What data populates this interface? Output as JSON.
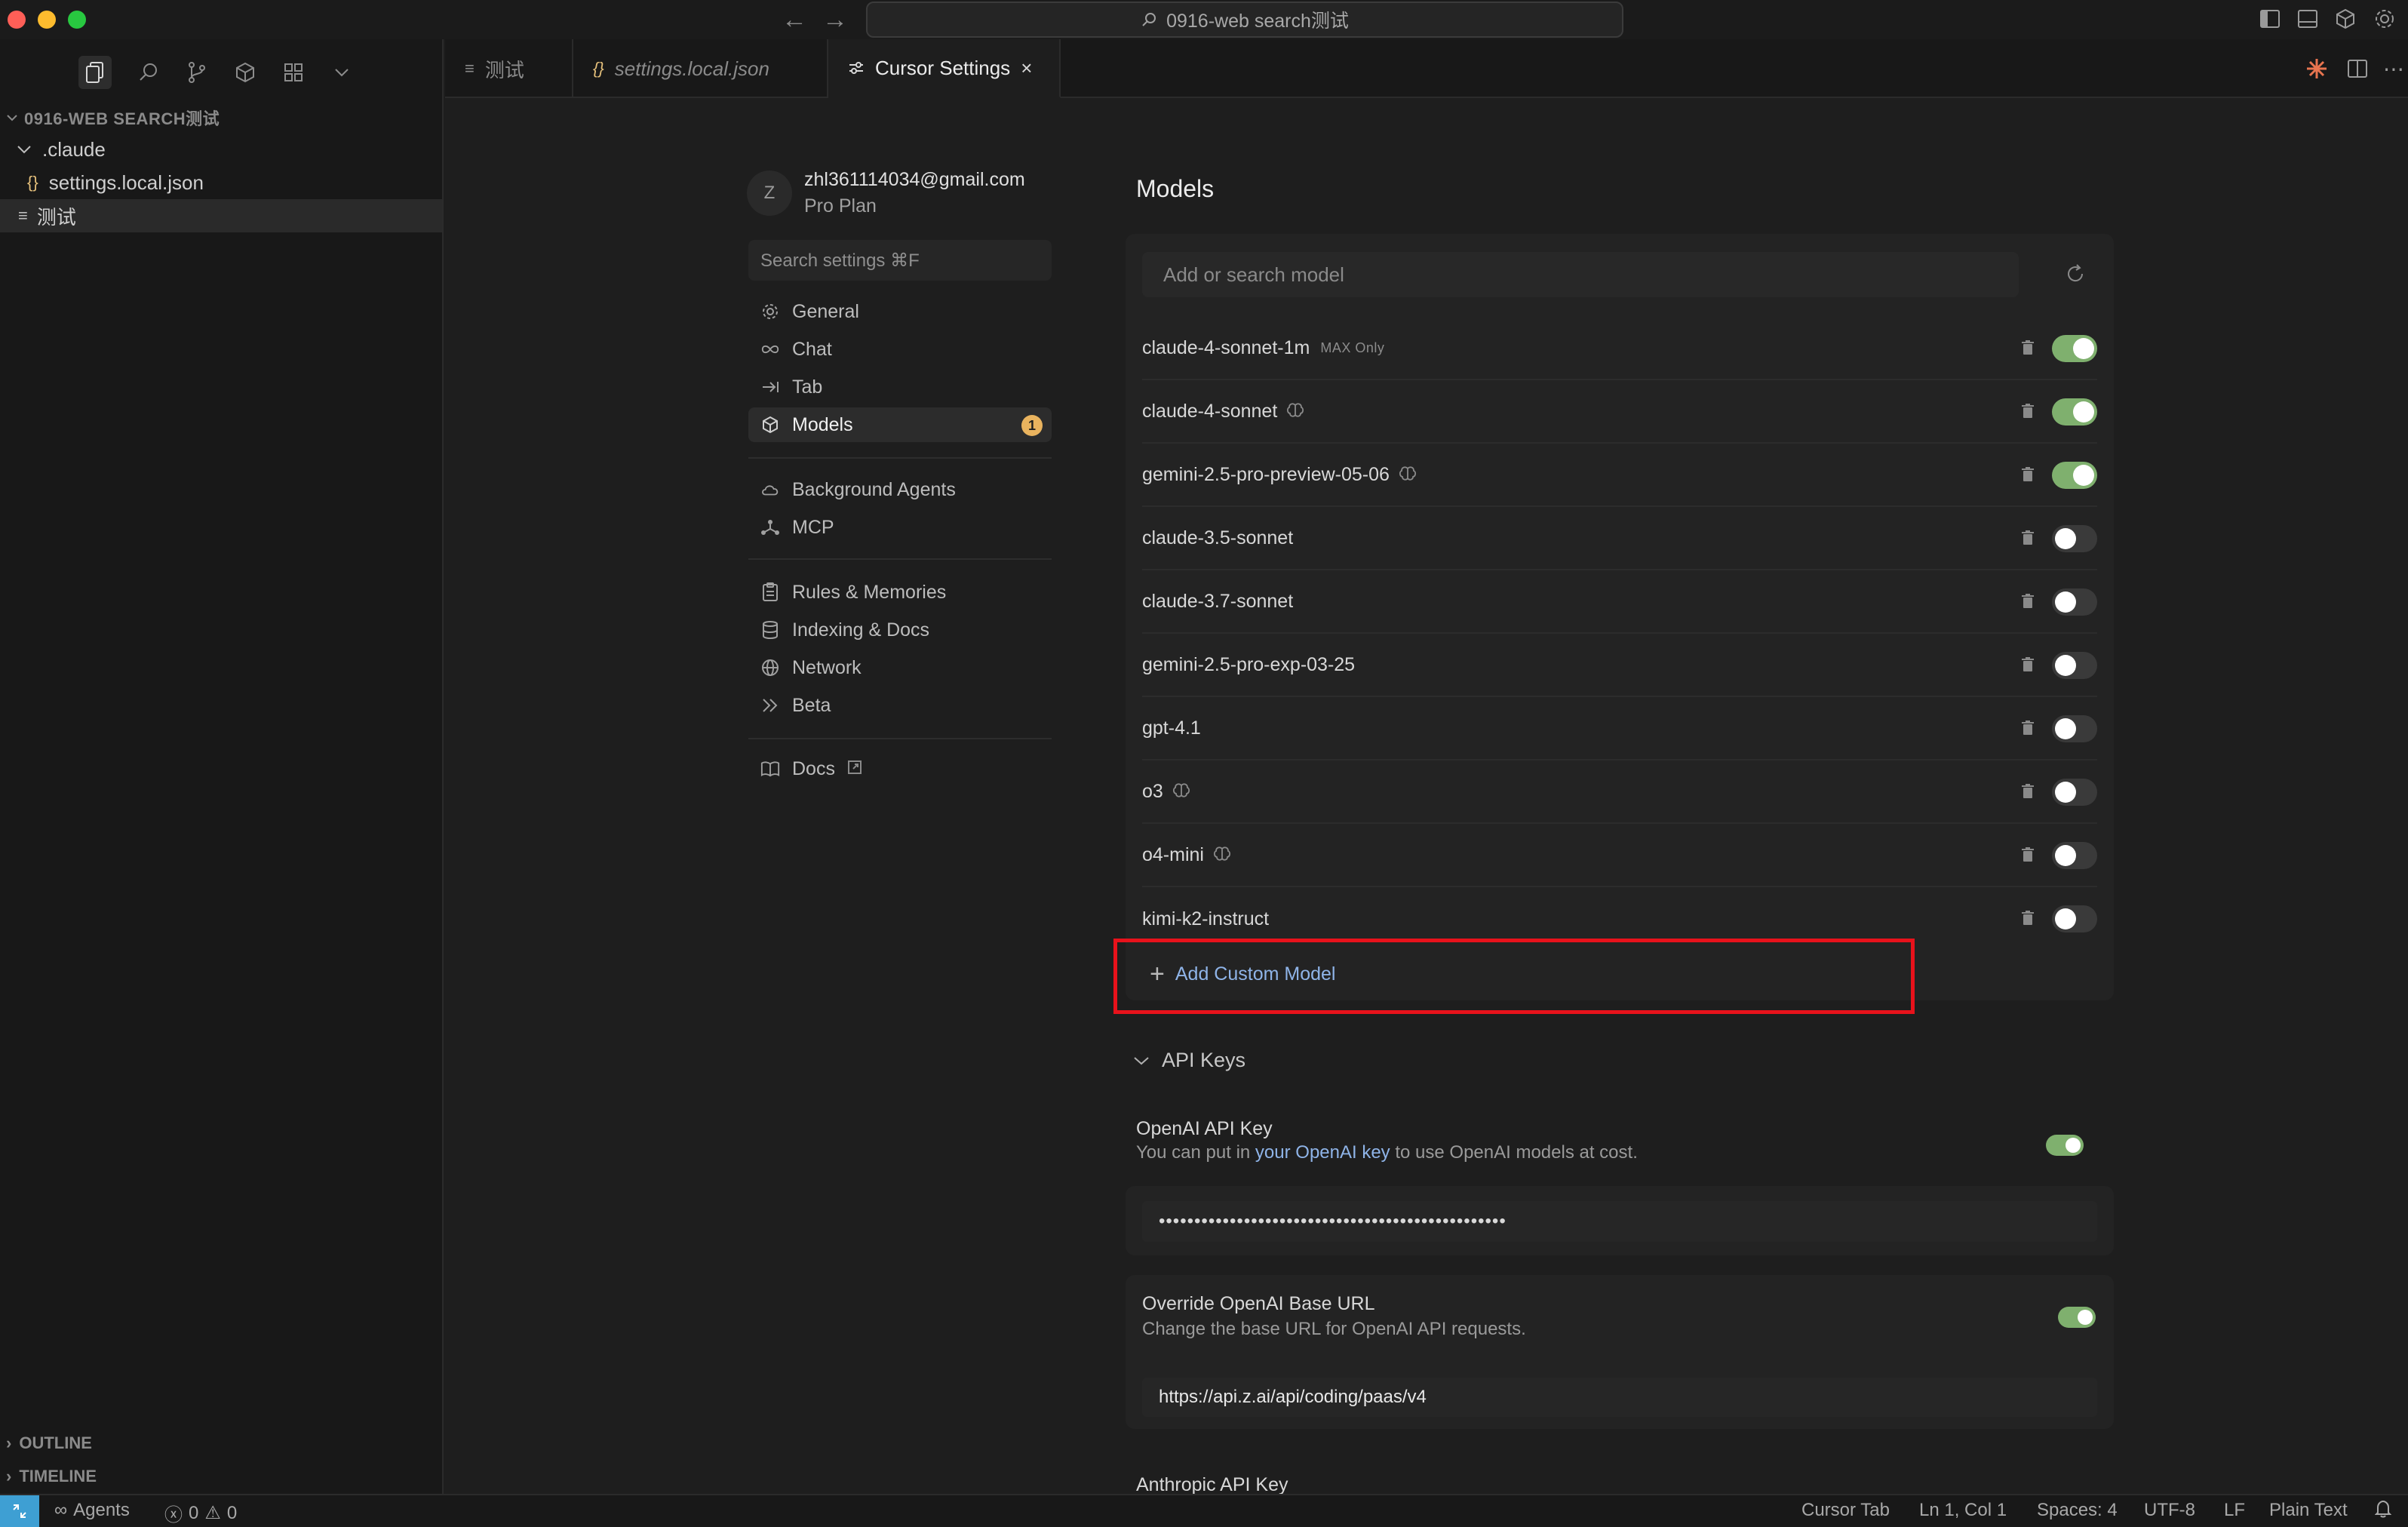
{
  "window": {
    "search_title": "0916-web search测试"
  },
  "sidebar": {
    "explorer_title": "0916-WEB SEARCH测试",
    "tree": [
      {
        "label": ".claude",
        "type": "folder"
      },
      {
        "label": "settings.local.json",
        "type": "json"
      },
      {
        "label": "测试",
        "type": "text"
      }
    ],
    "outline_label": "OUTLINE",
    "timeline_label": "TIMELINE"
  },
  "tabs": [
    {
      "label": "测试"
    },
    {
      "label": "settings.local.json"
    },
    {
      "label": "Cursor Settings"
    }
  ],
  "account": {
    "avatar_letter": "Z",
    "email": "zhl361114034@gmail.com",
    "plan": "Pro Plan"
  },
  "settings_search_placeholder": "Search settings ⌘F",
  "nav": [
    {
      "label": "General",
      "icon": "gear-icon"
    },
    {
      "label": "Chat",
      "icon": "infinity-icon"
    },
    {
      "label": "Tab",
      "icon": "tab-arrow-icon"
    },
    {
      "label": "Models",
      "icon": "cube-icon",
      "badge": "1"
    },
    {
      "label": "Background Agents",
      "icon": "cloud-icon"
    },
    {
      "label": "MCP",
      "icon": "network-nodes-icon"
    },
    {
      "label": "Rules & Memories",
      "icon": "clipboard-icon"
    },
    {
      "label": "Indexing & Docs",
      "icon": "database-icon"
    },
    {
      "label": "Network",
      "icon": "globe-icon"
    },
    {
      "label": "Beta",
      "icon": "chevrons-icon"
    },
    {
      "label": "Docs",
      "icon": "book-icon"
    }
  ],
  "models": {
    "heading": "Models",
    "search_placeholder": "Add or search model",
    "list": [
      {
        "name": "claude-4-sonnet-1m",
        "tag": "MAX Only",
        "thinking": false,
        "enabled": true
      },
      {
        "name": "claude-4-sonnet",
        "tag": "",
        "thinking": true,
        "enabled": true
      },
      {
        "name": "gemini-2.5-pro-preview-05-06",
        "tag": "",
        "thinking": true,
        "enabled": true
      },
      {
        "name": "claude-3.5-sonnet",
        "tag": "",
        "thinking": false,
        "enabled": false
      },
      {
        "name": "claude-3.7-sonnet",
        "tag": "",
        "thinking": false,
        "enabled": false
      },
      {
        "name": "gemini-2.5-pro-exp-03-25",
        "tag": "",
        "thinking": false,
        "enabled": false
      },
      {
        "name": "gpt-4.1",
        "tag": "",
        "thinking": false,
        "enabled": false
      },
      {
        "name": "o3",
        "tag": "",
        "thinking": true,
        "enabled": false
      },
      {
        "name": "o4-mini",
        "tag": "",
        "thinking": true,
        "enabled": false
      },
      {
        "name": "kimi-k2-instruct",
        "tag": "",
        "thinking": false,
        "enabled": false
      }
    ],
    "add_custom_label": "Add Custom Model"
  },
  "api_keys": {
    "section_label": "API Keys",
    "openai": {
      "title": "OpenAI API Key",
      "desc_prefix": "You can put in ",
      "desc_link": "your OpenAI key",
      "desc_suffix": " to use OpenAI models at cost.",
      "enabled": true,
      "masked_value": "•••••••••••••••••••••••••••••••••••••••••••••••••"
    },
    "override": {
      "title": "Override OpenAI Base URL",
      "desc": "Change the base URL for OpenAI API requests.",
      "enabled": true,
      "url": "https://api.z.ai/api/coding/paas/v4"
    },
    "anthropic_title": "Anthropic API Key"
  },
  "statusbar": {
    "agents": "Agents",
    "errors": "0",
    "warnings": "0",
    "cursor_tab": "Cursor Tab",
    "position": "Ln 1, Col 1",
    "spaces": "Spaces: 4",
    "encoding": "UTF-8",
    "eol": "LF",
    "language": "Plain Text"
  },
  "colors": {
    "accent_toggle": "#7fb06e",
    "highlight": "#e8121b",
    "badge": "#e9b35e",
    "link": "#8fb4e8"
  }
}
